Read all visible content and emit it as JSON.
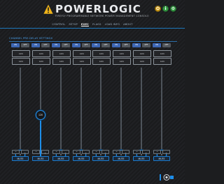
{
  "app": {
    "brand": "POWERLOGIC",
    "tagline": "FIREFLY PROGRAMMABLE NETWORK POWER MANAGEMENT CONSOLE",
    "header_buttons": [
      {
        "icon": "power-icon",
        "color": "#d9a41a"
      },
      {
        "icon": "info-icon",
        "color": "#3aa64a"
      },
      {
        "icon": "settings-icon",
        "color": "#3aa64a"
      }
    ]
  },
  "nav": {
    "tabs": [
      {
        "label": "CONTROL"
      },
      {
        "label": "SETUP"
      },
      {
        "label": "EXEC",
        "active": true
      },
      {
        "label": "FLAGS"
      },
      {
        "label": "LOAD INFO"
      },
      {
        "label": "ABOUT"
      }
    ]
  },
  "section": {
    "title": "CHANNEL PRE-DELAY SETTINGS"
  },
  "channels": [
    {
      "btn_a": "ON",
      "btn_b": "OFF",
      "box1": "Link",
      "box2": "Link",
      "level": 0,
      "value": "0",
      "mute": "MUTE"
    },
    {
      "btn_a": "ON",
      "btn_b": "OFF",
      "box1": "Link",
      "box2": "Link",
      "level": 0.48,
      "value": "120",
      "mute": "MUTE"
    },
    {
      "btn_a": "ON",
      "btn_b": "OFF",
      "box1": "Link",
      "box2": "Link",
      "level": 0,
      "value": "0",
      "mute": "MUTE"
    },
    {
      "btn_a": "ON",
      "btn_b": "OFF",
      "box1": "Link",
      "box2": "Link",
      "level": 0,
      "value": "0",
      "mute": "MUTE"
    },
    {
      "btn_a": "ON",
      "btn_b": "OFF",
      "box1": "Link",
      "box2": "Link",
      "level": 0,
      "value": "0",
      "mute": "MUTE"
    },
    {
      "btn_a": "ON",
      "btn_b": "OFF",
      "box1": "Link",
      "box2": "Link",
      "level": 0,
      "value": "0",
      "mute": "MUTE"
    },
    {
      "btn_a": "ON",
      "btn_b": "OFF",
      "box1": "Link",
      "box2": "Link",
      "level": 0,
      "value": "0",
      "mute": "MUTE"
    },
    {
      "btn_a": "ON",
      "btn_b": "OFF",
      "box1": "Link",
      "box2": "Link",
      "level": 0,
      "value": "0",
      "mute": "MUTE"
    }
  ],
  "arrows": {
    "up": "⌃",
    "down": "⌄"
  },
  "colors": {
    "accent": "#1d8de8",
    "brand_warning": "#e7b019"
  }
}
